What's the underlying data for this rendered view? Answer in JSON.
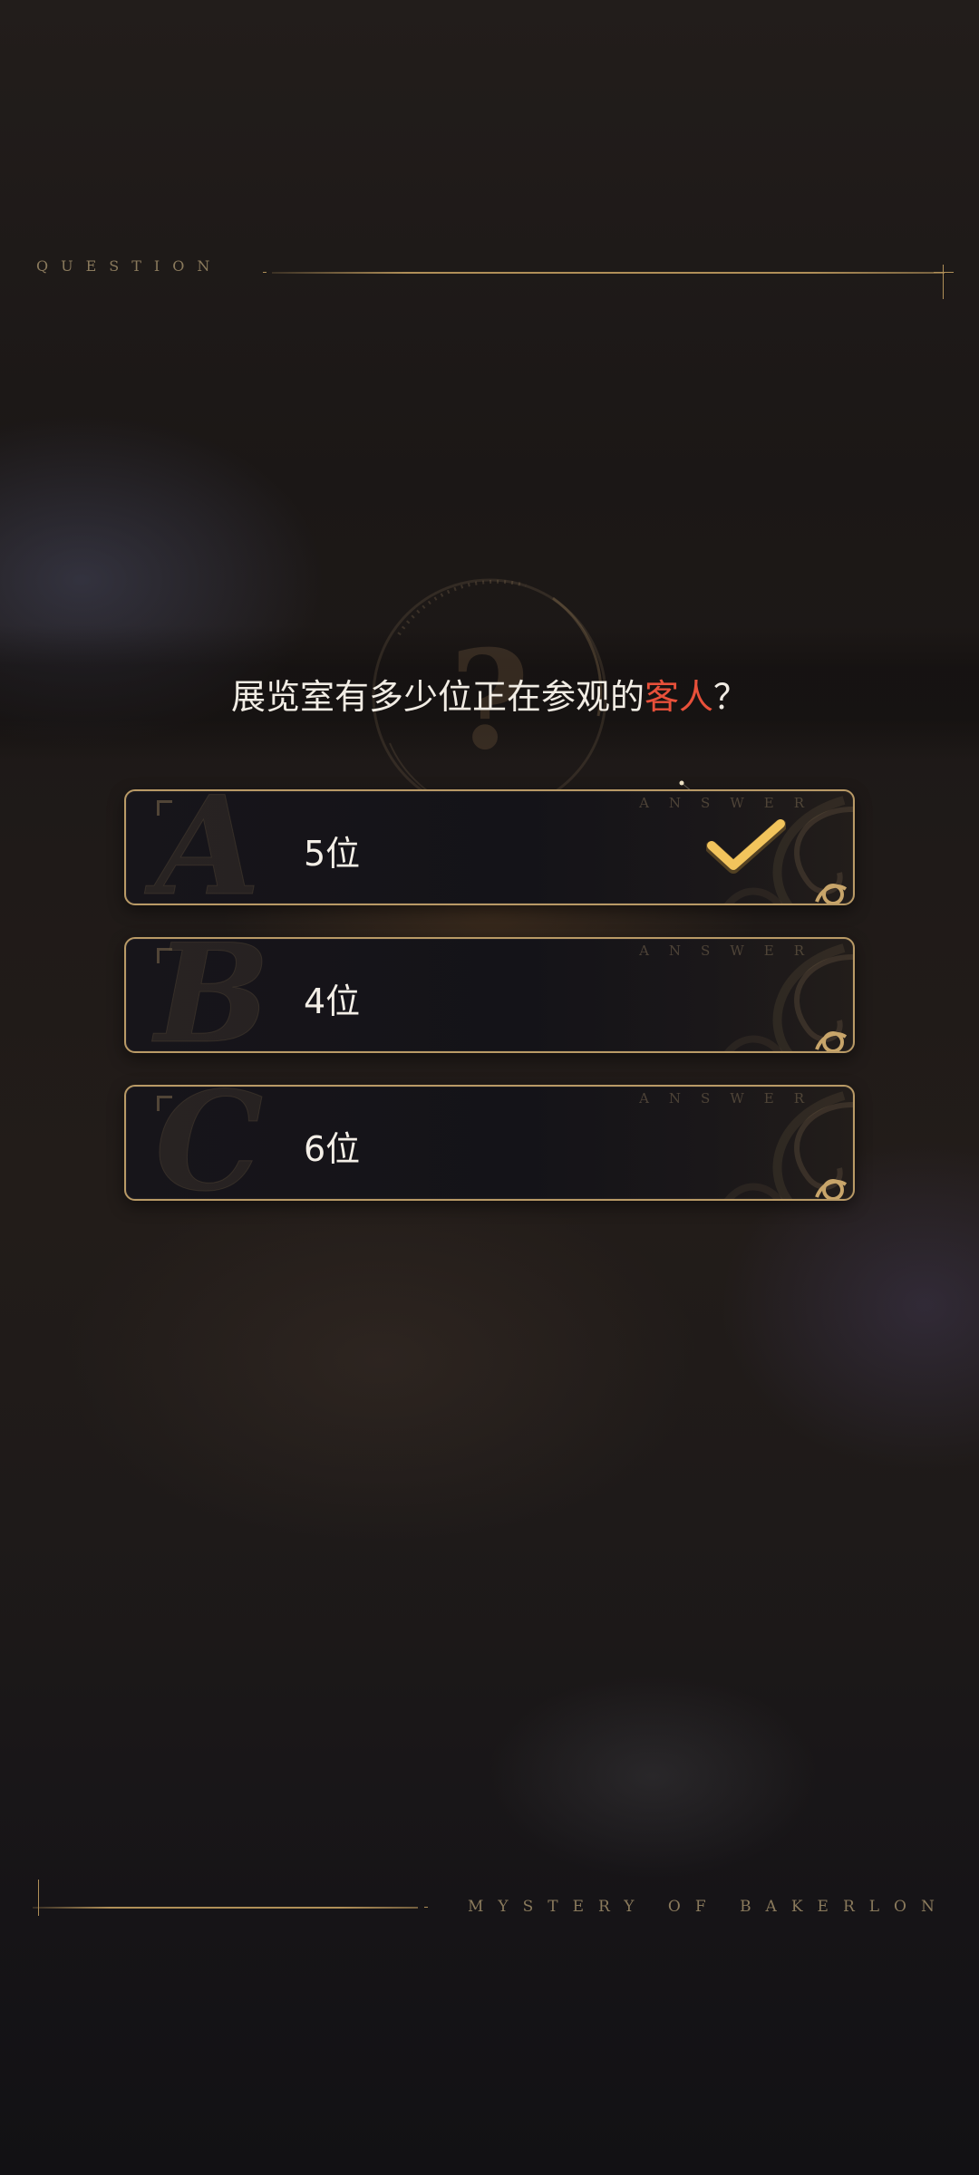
{
  "header": {
    "question_tag": "QUESTION"
  },
  "question": {
    "text_before": "展览室有多少位正在参观的",
    "text_accent": "客人",
    "text_after": "？",
    "accent_color": "#e8503a"
  },
  "options": [
    {
      "letter": "A",
      "label": "5位",
      "tag": "ANSWER",
      "selected": true
    },
    {
      "letter": "B",
      "label": "4位",
      "tag": "ANSWER",
      "selected": false
    },
    {
      "letter": "C",
      "label": "6位",
      "tag": "ANSWER",
      "selected": false
    }
  ],
  "footer": {
    "tagline": "MYSTERY OF BAKERLON"
  },
  "colors": {
    "gold": "#b99a66",
    "check": "#f2c45c",
    "background": "#1e1a19"
  },
  "icons": {
    "question_emblem": "question-mark-emblem-icon",
    "selected": "check-icon",
    "ornament": "scroll-ornament-icon"
  }
}
